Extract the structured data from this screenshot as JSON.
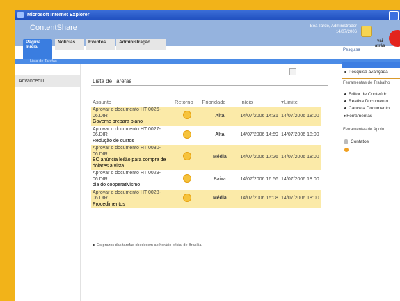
{
  "window": {
    "title": "Microsoft Internet Explorer"
  },
  "app": {
    "title": "ContentShare",
    "greeting": "Boa Tarde, Administrador",
    "date": "14/07/2006"
  },
  "tabs": [
    {
      "label": "Página Inicial"
    },
    {
      "label": "Notícias"
    },
    {
      "label": "Eventos"
    },
    {
      "label": "Administração"
    }
  ],
  "subbar": {
    "label": "Lista de Tarefas"
  },
  "search": {
    "label": "Pesquisa",
    "go": "vai",
    "back": "atrás"
  },
  "leftnav": {
    "items": [
      {
        "label": "AdvancedIT"
      }
    ]
  },
  "main": {
    "title": "Lista de Tarefas",
    "headers": {
      "assunto": "Assunto",
      "retorno": "Retorno",
      "prioridade": "Prioridade",
      "inicio": "Início",
      "limite": "▾Limite"
    },
    "rows": [
      {
        "desc": "Aprovar o documento HT 0026-06.DIR",
        "sub": "Governo prepara plano",
        "prioridade": "Alta",
        "inicio": "14/07/2006 14:31",
        "limite": "14/07/2006 18:00"
      },
      {
        "desc": "Aprovar o documento HT 0027-06.DIR",
        "sub": "Redução de custos",
        "prioridade": "Alta",
        "inicio": "14/07/2006 14:59",
        "limite": "14/07/2006 18:00"
      },
      {
        "desc": "Aprovar o documento HT 0030-06.DIR",
        "sub": "BC anúncia leilão para compra de dólares à vista",
        "prioridade": "Média",
        "inicio": "14/07/2006 17:26",
        "limite": "14/07/2006 18:00"
      },
      {
        "desc": "Aprovar o documento HT 0029-06.DIR",
        "sub": "dia do cooperativismo",
        "prioridade": "Baixa",
        "inicio": "14/07/2006 16:56",
        "limite": "14/07/2006 18:00"
      },
      {
        "desc": "Aprovar o documento HT 0028-06.DIR",
        "sub": "Procedimentos",
        "prioridade": "Média",
        "inicio": "14/07/2006 15:08",
        "limite": "14/07/2006 18:00"
      }
    ],
    "note": "Os prazos das tarefas obedecem ao horário oficial de Brasília."
  },
  "right": {
    "advanced_search": "Pesquisa avançada",
    "tools_head": "Ferramentas de Trabalho",
    "tools": [
      "Editor de Conteúdo",
      "Reativa Documento",
      "Cancela Documento"
    ],
    "tools_more": "▸Ferramentas",
    "support_head": "Ferramentas de Apoio",
    "contacts": "Contatos"
  }
}
